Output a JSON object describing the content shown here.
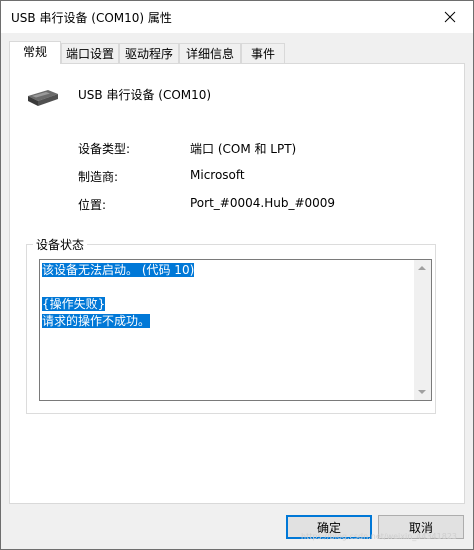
{
  "window": {
    "title": "USB 串行设备 (COM10) 属性",
    "close_glyph": "✕"
  },
  "tabs": [
    {
      "label": "常规",
      "active": true
    },
    {
      "label": "端口设置",
      "active": false
    },
    {
      "label": "驱动程序",
      "active": false
    },
    {
      "label": "详细信息",
      "active": false
    },
    {
      "label": "事件",
      "active": false
    }
  ],
  "device": {
    "icon": "usb-serial-device-icon",
    "name": "USB 串行设备 (COM10)"
  },
  "properties": [
    {
      "label": "设备类型:",
      "value": "端口 (COM 和 LPT)"
    },
    {
      "label": "制造商:",
      "value": "Microsoft"
    },
    {
      "label": "位置:",
      "value": "Port_#0004.Hub_#0009"
    }
  ],
  "status": {
    "group_title": "设备状态",
    "lines": [
      "该设备无法启动。 (代码 10)",
      "",
      "{操作失败}",
      "请求的操作不成功。"
    ]
  },
  "buttons": {
    "ok": "确定",
    "cancel": "取消"
  },
  "watermark": "https://blog.csdn.net/weixin_44341823",
  "colors": {
    "selection": "#0078d7",
    "default_button_border": "#0078d7"
  }
}
